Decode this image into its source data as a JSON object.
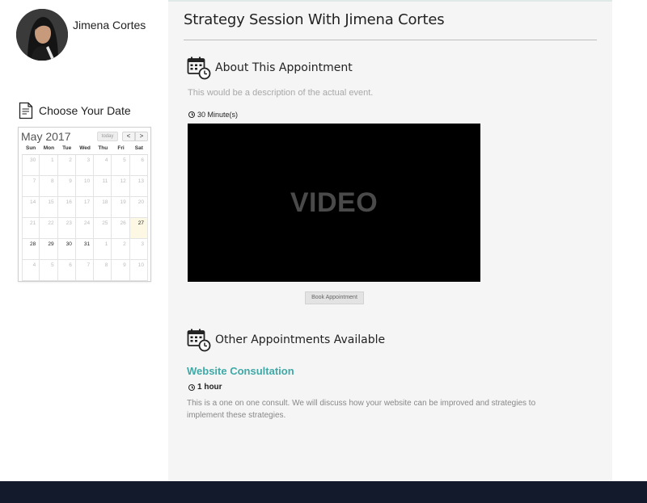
{
  "profile": {
    "name": "Jimena Cortes"
  },
  "sidebar": {
    "choose_date_label": "Choose Your Date",
    "calendar": {
      "month_label": "May 2017",
      "today_label": "today",
      "prev_label": "<",
      "next_label": ">",
      "weekdays": [
        "Sun",
        "Mon",
        "Tue",
        "Wed",
        "Thu",
        "Fri",
        "Sat"
      ],
      "weeks": [
        [
          "30",
          "1",
          "2",
          "3",
          "4",
          "5",
          "6"
        ],
        [
          "7",
          "8",
          "9",
          "10",
          "11",
          "12",
          "13"
        ],
        [
          "14",
          "15",
          "16",
          "17",
          "18",
          "19",
          "20"
        ],
        [
          "21",
          "22",
          "23",
          "24",
          "25",
          "26",
          "27"
        ],
        [
          "28",
          "29",
          "30",
          "31",
          "1",
          "2",
          "3"
        ],
        [
          "4",
          "5",
          "6",
          "7",
          "8",
          "9",
          "10"
        ]
      ],
      "today_day": "27",
      "active_days": [
        "27",
        "28",
        "29",
        "30",
        "31"
      ]
    }
  },
  "main": {
    "title": "Strategy Session With Jimena Cortes",
    "about": {
      "heading": "About This Appointment",
      "description": "This would be a description of the actual event.",
      "duration": "30 Minute(s)",
      "video_label": "VIDEO",
      "book_button": "Book Appointment"
    },
    "other": {
      "heading": "Other Appointments Available",
      "items": [
        {
          "title": "Website Consultation",
          "duration": "1 hour",
          "description": "This is a one on one consult. We will discuss how your website can be improved and strategies to implement these strategies."
        }
      ]
    }
  },
  "colors": {
    "accent": "#3ea9a7",
    "footer": "#121a2b",
    "main_bg": "#f5f5f5"
  },
  "icons": {
    "calendar_clock": "calendar-clock-icon",
    "document": "document-icon",
    "clock": "clock-icon"
  }
}
